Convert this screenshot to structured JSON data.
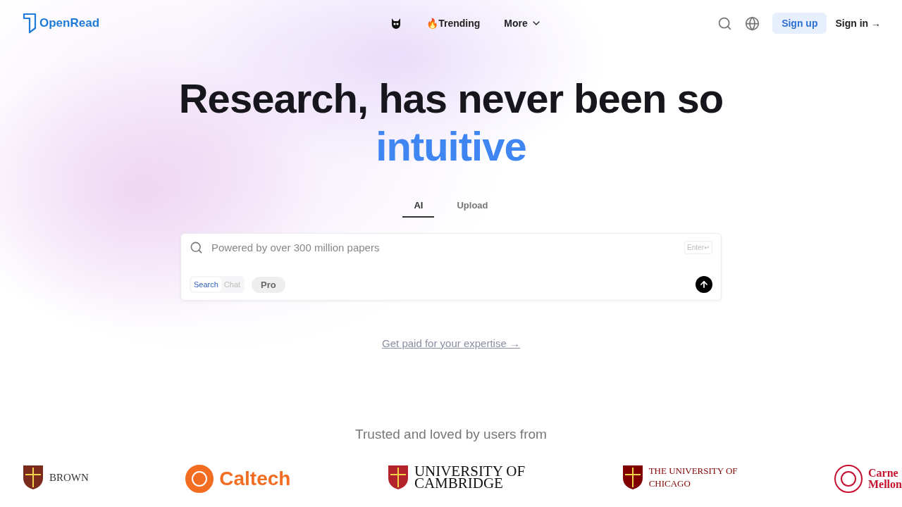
{
  "header": {
    "brand": "OpenRead",
    "nav": [
      {
        "kind": "icon"
      },
      {
        "kind": "link",
        "icon": "🔥",
        "label": "Trending"
      },
      {
        "kind": "menu",
        "label": "More"
      }
    ],
    "sign_up": "Sign up",
    "sign_in": "Sign in →"
  },
  "hero": {
    "title": "Research, has never been so",
    "highlight": "intuitive"
  },
  "tabs": [
    {
      "label": "AI",
      "selected": true
    },
    {
      "label": "Upload",
      "selected": false
    }
  ],
  "search": {
    "placeholder": "Powered by over 300 million papers",
    "enter_hint": "Enter↵",
    "modes": [
      {
        "label": "Search",
        "selected": true
      },
      {
        "label": "Chat",
        "selected": false
      }
    ],
    "pro": "Pro"
  },
  "promo_link": "Get paid for your expertise →",
  "trusted": {
    "heading": "Trusted and loved by users from",
    "logos": [
      {
        "kind": "brown",
        "lines": [
          "BROWN"
        ]
      },
      {
        "kind": "caltech",
        "lines": [
          "Caltech"
        ]
      },
      {
        "kind": "cambridge",
        "lines": [
          "UNIVERSITY OF",
          "CAMBRIDGE"
        ]
      },
      {
        "kind": "chicago",
        "lines": [
          "THE UNIVERSITY OF",
          "CHICAGO"
        ]
      },
      {
        "kind": "cmu",
        "lines": [
          "Carne",
          "Mellon"
        ]
      }
    ]
  }
}
